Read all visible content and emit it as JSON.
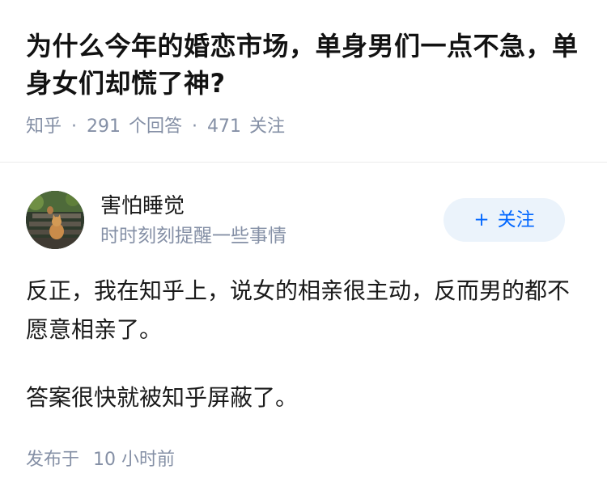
{
  "question": {
    "title": "为什么今年的婚恋市场，单身男们一点不急，单身女们却慌了神?",
    "source": "知乎",
    "answer_count": "291",
    "answer_unit": "个回答",
    "follower_count": "471",
    "follower_unit": "关注"
  },
  "author": {
    "name": "害怕睡觉",
    "bio": "时时刻刻提醒一些事情",
    "follow_plus": "+",
    "follow_label": "关注"
  },
  "answer": {
    "paragraphs": [
      "反正，我在知乎上，说女的相亲很主动，反而男的都不愿意相亲了。",
      "答案很快就被知乎屏蔽了。"
    ],
    "time_prefix": "发布于",
    "time_value": "10 小时前"
  },
  "colors": {
    "accent": "#0066ff",
    "follow_bg": "#ebf3fb",
    "meta_gray": "#8590a6"
  },
  "icons": {
    "avatar": "cat-on-stairs-photo"
  }
}
